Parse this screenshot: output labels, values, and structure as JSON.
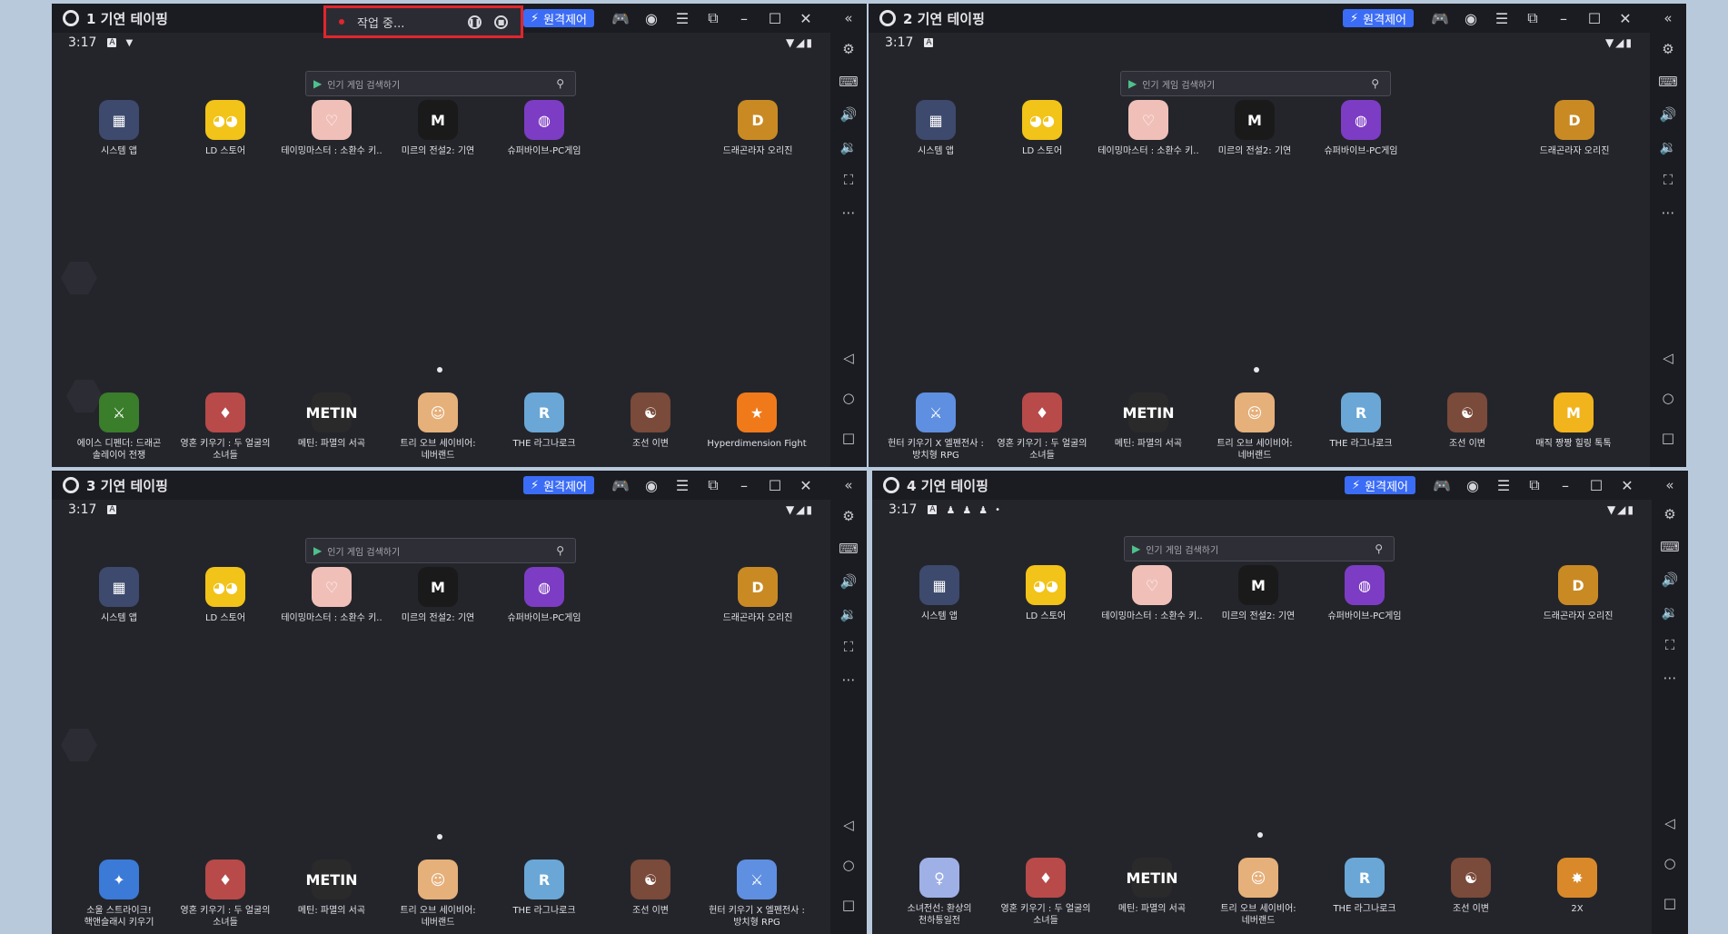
{
  "windows": [
    {
      "title": "1 기연 테이핑",
      "remote_label": "원격제어",
      "clock": "3:17",
      "search_placeholder": "인기 게임 검색하기",
      "top_apps": [
        "시스템 앱",
        "LD 스토어",
        "테이밍마스터 : 소환수 키..",
        "미르의 전설2: 기연",
        "슈퍼바이브-PC게임",
        "드래곤라자 오리진"
      ],
      "bottom_apps": [
        "에이스 디펜더: 드래곤 솔레이어 전쟁",
        "영혼 키우기 : 두 얼굴의 소녀들",
        "메틴: 파멸의 서곡",
        "트리 오브 세이비어: 네버랜드",
        "THE 라그나로크",
        "조선 이변",
        "Hyperdimension Fight"
      ]
    },
    {
      "title": "2 기연 테이핑",
      "remote_label": "원격제어",
      "clock": "3:17",
      "search_placeholder": "인기 게임 검색하기",
      "top_apps": [
        "시스템 앱",
        "LD 스토어",
        "테이밍마스터 : 소환수 키..",
        "미르의 전설2: 기연",
        "슈퍼바이브-PC게임",
        "드래곤라자 오리진"
      ],
      "bottom_apps": [
        "헌터 키우기 X 엘펜전사 : 방치형 RPG",
        "영혼 키우기 : 두 얼굴의 소녀들",
        "메틴: 파멸의 서곡",
        "트리 오브 세이비어: 네버랜드",
        "THE 라그나로크",
        "조선 이변",
        "매직 짱짱 힐링 톡톡"
      ]
    },
    {
      "title": "3 기연 테이핑",
      "remote_label": "원격제어",
      "clock": "3:17",
      "search_placeholder": "인기 게임 검색하기",
      "top_apps": [
        "시스템 앱",
        "LD 스토어",
        "테이밍마스터 : 소환수 키..",
        "미르의 전설2: 기연",
        "슈퍼바이브-PC게임",
        "드래곤라자 오리진"
      ],
      "bottom_apps": [
        "소울 스트라이크! 핵앤슬래시 키우기",
        "영혼 키우기 : 두 얼굴의 소녀들",
        "메틴: 파멸의 서곡",
        "트리 오브 세이비어: 네버랜드",
        "THE 라그나로크",
        "조선 이변",
        "헌터 키우기 X 엘펜전사 : 방치형 RPG"
      ]
    },
    {
      "title": "4 기연 테이핑",
      "remote_label": "원격제어",
      "clock": "3:17",
      "search_placeholder": "인기 게임 검색하기",
      "top_apps": [
        "시스템 앱",
        "LD 스토어",
        "테이밍마스터 : 소환수 키..",
        "미르의 전설2: 기연",
        "슈퍼바이브-PC게임",
        "드래곤라자 오리진"
      ],
      "bottom_apps": [
        "소녀전선: 환상의 천하통일전",
        "영혼 키우기 : 두 얼굴의 소녀들",
        "메틴: 파멸의 서곡",
        "트리 오브 세이비어: 네버랜드",
        "THE 라그나로크",
        "조선 이변",
        "2X"
      ]
    }
  ],
  "task_banner": {
    "label": "작업 중..."
  },
  "metin_logo": "METIN",
  "colors": {
    "remote_blue": "#3b6cf6",
    "banner_red": "#e0262c",
    "bg": "#24252b"
  }
}
